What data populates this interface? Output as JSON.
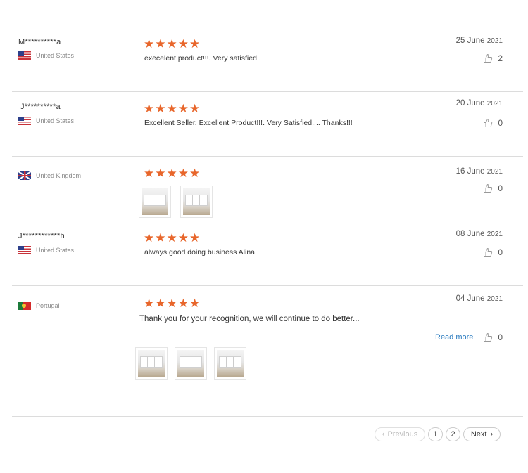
{
  "reviews": [
    {
      "name": "M**********a",
      "country": "United States",
      "flag": "us",
      "stars": 5,
      "text": "execelent product!!!.  Very satisfied .",
      "date_day": "25  June",
      "date_year": "2021",
      "likes": "2"
    },
    {
      "name": "J**********a",
      "country": "United States",
      "flag": "us",
      "stars": 5,
      "text": "Excellent Seller. Excellent Product!!!.  Very Satisfied.... Thanks!!!",
      "date_day": "20  June",
      "date_year": "2021",
      "likes": "0"
    },
    {
      "name": "",
      "country": "United Kingdom",
      "flag": "uk",
      "stars": 5,
      "text": "",
      "date_day": "16  June",
      "date_year": "2021",
      "likes": "0",
      "photos": 2
    },
    {
      "name": "J************h",
      "country": "United States",
      "flag": "us",
      "stars": 5,
      "text": "always good doing business Alina",
      "date_day": "08  June",
      "date_year": "2021",
      "likes": "0"
    },
    {
      "name": "",
      "country": "Portugal",
      "flag": "pt",
      "stars": 5,
      "text": "Thank you for your recognition, we will continue to do better...",
      "date_day": "04 June",
      "date_year": "2021",
      "likes": "0",
      "read_more": "Read more",
      "photos": 3
    }
  ],
  "star_glyph": "★",
  "colors": {
    "star": "#e8662b",
    "link": "#2a7bbf"
  },
  "icons": {
    "like": "thumbs-up-icon"
  },
  "pagination": {
    "previous": "Previous",
    "pages": [
      "1",
      "2"
    ],
    "next": "Next",
    "current_page": "1"
  }
}
